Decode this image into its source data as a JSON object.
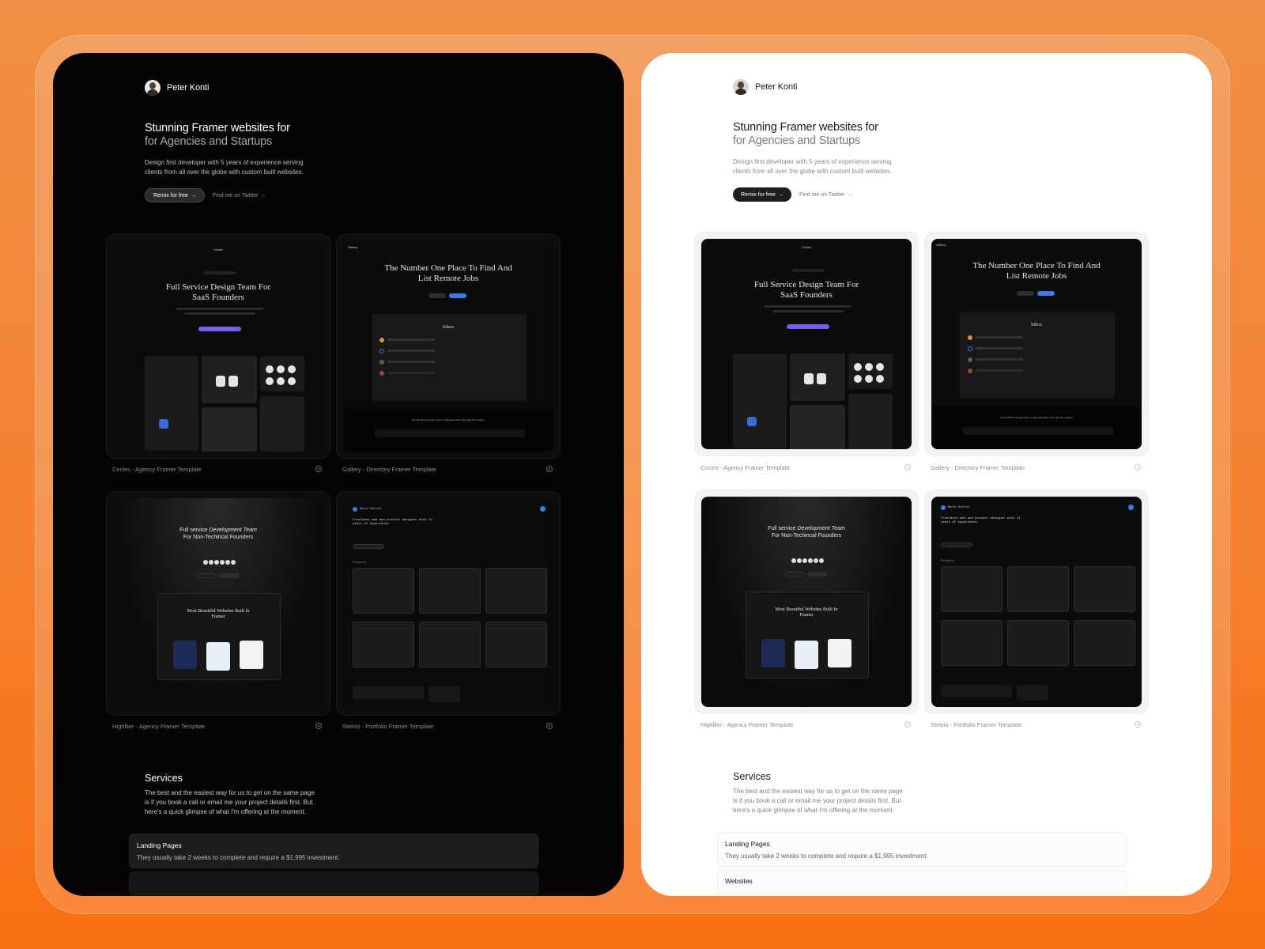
{
  "profile": {
    "name": "Peter Konti"
  },
  "hero": {
    "line1": "Stunning Framer websites for",
    "line2": "for Agencies and Startups",
    "description": "Design first developer with 5 years of experience serving clients from all over the globe with custom built websites."
  },
  "cta": {
    "primary": "Remix for free",
    "secondary": "Find me on Twitter",
    "arrow": "→"
  },
  "projects": [
    {
      "label": "Circles - Agency Framer Template",
      "preview_title": "Full Service Design Team For SaaS Founders",
      "preview_brand": "Circles"
    },
    {
      "label": "Gallery - Directory Framer Template",
      "preview_title": "The Number One Place To Find And List Remote Jobs",
      "preview_inbox": "Inbox",
      "preview_footer": "Worlds Best Startups Have Companies Hire Through The Gallery",
      "preview_brand": "Gallery"
    },
    {
      "label": "Highflier - Agency Framer Template",
      "preview_title_a": "Full service",
      "preview_title_b": "Development Team",
      "preview_title_c": "For Non-Techincal Founders",
      "preview_sub": "Most Beautiful Websites Built In Framer"
    },
    {
      "label": "Stelvio - Portfolio Framer Template",
      "preview_brand": "Mario Stelvio",
      "preview_text": "Freelance web and product designer with 11 years of experience.",
      "preview_section": "Projects"
    }
  ],
  "services": {
    "title": "Services",
    "description": "The best and the easiest way for us to get on the same page is if you book a call or email me your project details first. But here's a quick glimpse of what I'm offering at the moment.",
    "items": [
      {
        "name": "Landing Pages",
        "description": "They usually take 2 weeks to complete and require a $1,995 investment."
      },
      {
        "name": "Websites",
        "description": ""
      }
    ]
  },
  "colors": {
    "background": "#f58232",
    "dark_panel": "#050505",
    "light_panel": "#ffffff",
    "accent_purple": "#7b5cf0",
    "accent_blue": "#3a7bf0"
  },
  "icons": {
    "card_action": "target-icon"
  }
}
